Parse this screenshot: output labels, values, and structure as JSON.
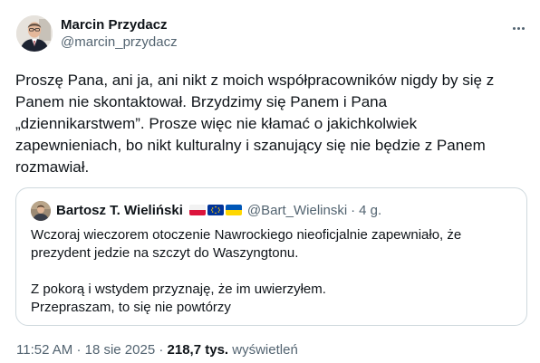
{
  "author": {
    "name": "Marcin Przydacz",
    "handle": "@marcin_przydacz"
  },
  "tweet": {
    "text": "Proszę Pana, ani ja, ani nikt z moich współpracowników nigdy by się z\nPanem nie skontaktował. Brzydzimy się Panem i Pana\n„dziennikarstwem”. Prosze więc nie kłamać o jakichkolwiek\nzapewnieniach, bo nikt kulturalny i szanujący się nie będzie z Panem\nrozmawiał."
  },
  "quote": {
    "name": "Bartosz T. Wieliński",
    "handle": "@Bart_Wielinski",
    "separator": "·",
    "time": "4 g.",
    "flags": [
      "poland-flag-icon",
      "eu-flag-icon",
      "ukraine-flag-icon"
    ],
    "text": "Wczoraj wieczorem otoczenie Nawrockiego nieoficjalnie zapewniało, że\nprezydent jedzie na szczyt do Waszyngtonu.\n\nZ pokorą i wstydem przyznaję, że im uwierzyłem.\nPrzepraszam, to się nie powtórzy"
  },
  "meta": {
    "time": "11:52 AM",
    "separator1": "·",
    "date": "18 sie 2025",
    "separator2": "·",
    "views_count": "218,7 tys.",
    "views_label": "wyświetleń"
  },
  "colors": {
    "text": "#0f1419",
    "secondary": "#536471",
    "border": "#cfd9de"
  }
}
